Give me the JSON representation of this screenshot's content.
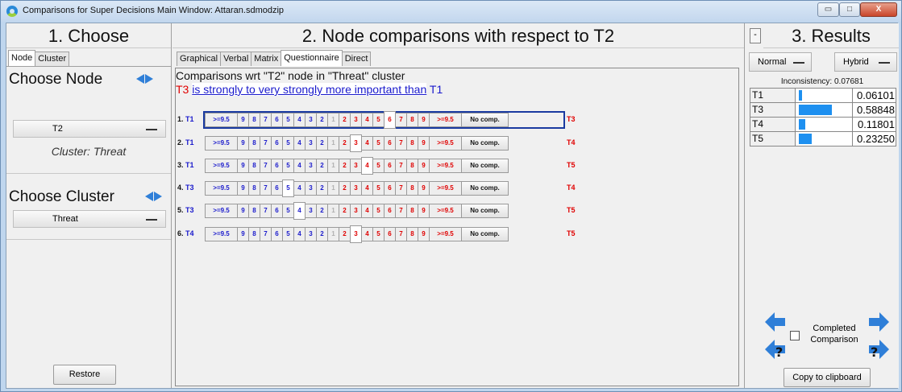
{
  "window": {
    "title": "Comparisons for Super Decisions Main Window: Attaran.sdmodzip",
    "controls": {
      "minimize": "▭",
      "maximize": "□",
      "close": "X"
    }
  },
  "choose": {
    "heading": "1. Choose",
    "tabs": [
      "Node",
      "Cluster"
    ],
    "choose_node_label": "Choose Node",
    "node_value": "T2",
    "cluster_caption": "Cluster: Threat",
    "choose_cluster_label": "Choose Cluster",
    "cluster_value": "Threat",
    "restore_label": "Restore"
  },
  "comparisons": {
    "heading": "2. Node comparisons with respect to T2",
    "tabs": [
      "Graphical",
      "Verbal",
      "Matrix",
      "Questionnaire",
      "Direct"
    ],
    "active_tab": "Questionnaire",
    "header_text": "Comparisons wrt \"T2\" node in \"Threat\" cluster",
    "verbal": {
      "left": "T3",
      "middle": "is strongly to very strongly more important than",
      "right": "T1"
    },
    "scale": [
      ">=9.5",
      "9",
      "8",
      "7",
      "6",
      "5",
      "4",
      "3",
      "2",
      "1",
      "2",
      "3",
      "4",
      "5",
      "6",
      "7",
      "8",
      "9",
      ">=9.5"
    ],
    "no_comp_label": "No comp.",
    "rows": [
      {
        "num": "1.",
        "left": "T1",
        "right": "T3",
        "selected": 14
      },
      {
        "num": "2.",
        "left": "T1",
        "right": "T4",
        "selected": 11
      },
      {
        "num": "3.",
        "left": "T1",
        "right": "T5",
        "selected": 12
      },
      {
        "num": "4.",
        "left": "T3",
        "right": "T4",
        "selected": 5
      },
      {
        "num": "5.",
        "left": "T3",
        "right": "T5",
        "selected": 6
      },
      {
        "num": "6.",
        "left": "T4",
        "right": "T5",
        "selected": 11
      }
    ],
    "colors": {
      "left_side": "#1a1acc",
      "right_side": "#e00000",
      "center": "#b0b0b0"
    }
  },
  "results": {
    "heading": "3. Results",
    "minus_label": "-",
    "mode_value": "Normal",
    "type_value": "Hybrid",
    "inconsistency_text": "Inconsistency: 0.07681",
    "rows": [
      {
        "name": "T1",
        "value": "0.06101",
        "weight": 0.06101
      },
      {
        "name": "T3",
        "value": "0.58848",
        "weight": 0.58848
      },
      {
        "name": "T4",
        "value": "0.11801",
        "weight": 0.11801
      },
      {
        "name": "T5",
        "value": "0.23250",
        "weight": 0.2325
      }
    ],
    "bar_color": "#1e90f0",
    "completed_label": "Completed Comparison",
    "completed_checked": false,
    "copy_label": "Copy to clipboard"
  }
}
